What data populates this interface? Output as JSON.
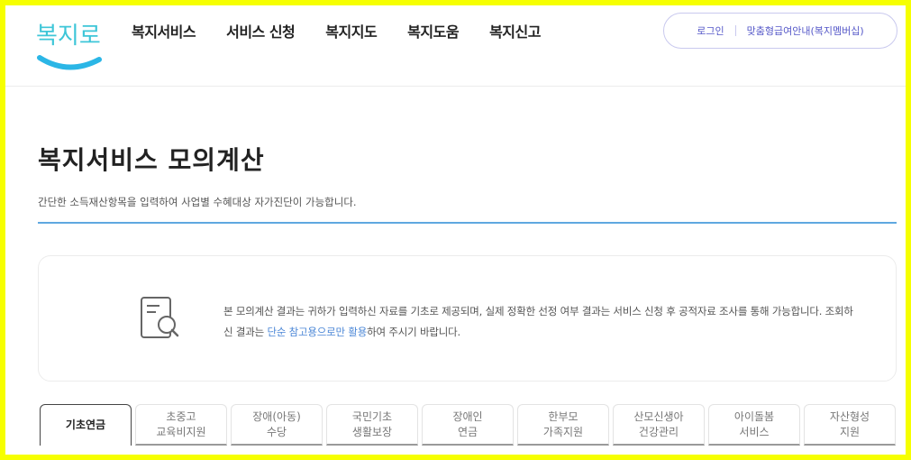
{
  "header": {
    "logo_text": "복지로",
    "nav": [
      "복지서비스",
      "서비스 신청",
      "복지지도",
      "복지도움",
      "복지신고"
    ],
    "login_label": "로그인",
    "membership_label": "맞춤형급여안내(복지멤버십)"
  },
  "page": {
    "title": "복지서비스 모의계산",
    "description": "간단한 소득재산항목을 입력하여 사업별 수혜대상 자가진단이 가능합니다."
  },
  "notice": {
    "text_part1": "본 모의계산 결과는 귀하가 입력하신 자료를 기초로 제공되며, 실제 정확한 선정 여부 결과는 서비스 신청 후 공적자료 조사를 통해 가능합니다. 조회하신 결과는 ",
    "text_highlight": "단순 참고용으로만 활용",
    "text_part2": "하여 주시기 바랍니다."
  },
  "tabs": [
    {
      "label": "기초연금",
      "active": true
    },
    {
      "label": "초중고\n교육비지원",
      "active": false
    },
    {
      "label": "장애(아동)\n수당",
      "active": false
    },
    {
      "label": "국민기초\n생활보장",
      "active": false
    },
    {
      "label": "장애인\n연금",
      "active": false
    },
    {
      "label": "한부모\n가족지원",
      "active": false
    },
    {
      "label": "산모신생아\n건강관리",
      "active": false
    },
    {
      "label": "아이돌봄\n서비스",
      "active": false
    },
    {
      "label": "자산형성\n지원",
      "active": false
    }
  ],
  "colors": {
    "frame": "#f6ff00",
    "accent_blue": "#5fa8e0",
    "highlight": "#4a86d6",
    "member_text": "#5558c8"
  }
}
